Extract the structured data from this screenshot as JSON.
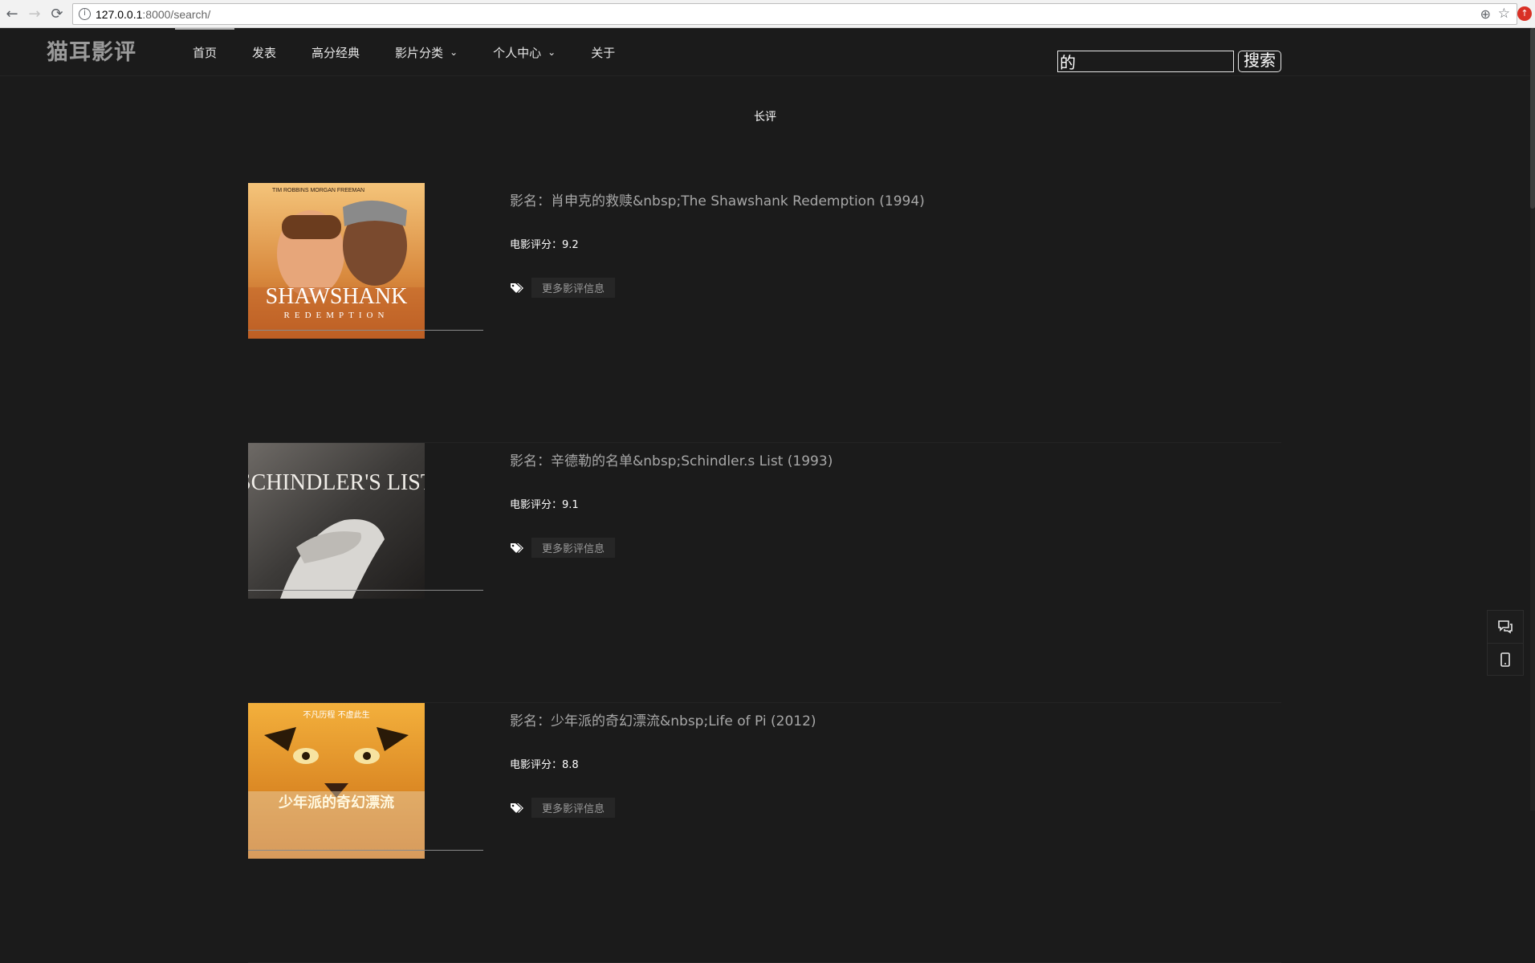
{
  "browser": {
    "url_host": "127.0.0.1",
    "url_rest": ":8000/search/"
  },
  "header": {
    "logo": "猫耳影评",
    "menu": [
      {
        "label": "首页"
      },
      {
        "label": "发表"
      },
      {
        "label": "高分经典"
      },
      {
        "label": "影片分类"
      },
      {
        "label": "个人中心"
      },
      {
        "label": "关于"
      }
    ],
    "search_value": "的",
    "search_button": "搜索"
  },
  "section_title": "长评",
  "movies": [
    {
      "title": "影名：肖申克的救赎&nbsp;The Shawshank Redemption (1994)",
      "score": "电影评分：9.2",
      "tag": "更多影评信息",
      "poster_top": "TIM ROBBINS   MORGAN FREEMAN",
      "poster_title": "SHAWSHANK",
      "poster_sub": "REDEMPTION"
    },
    {
      "title": "影名：辛德勒的名单&nbsp;Schindler.s List (1993)",
      "score": "电影评分：9.1",
      "tag": "更多影评信息",
      "poster_title": "SCHINDLER'S LIST"
    },
    {
      "title": "影名：少年派的奇幻漂流&nbsp;Life of Pi (2012)",
      "score": "电影评分：8.8",
      "tag": "更多影评信息",
      "poster_top": "不凡历程  不虚此生",
      "poster_title": "少年派的奇幻漂流"
    }
  ],
  "colors": {
    "background": "#1b1b1b",
    "header_text": "#e6e6e6",
    "title_text": "#a8a8a8"
  },
  "icons": [
    "back-arrow-icon",
    "forward-arrow-icon",
    "reload-icon",
    "info-icon",
    "zoom-icon",
    "star-icon",
    "chevron-down-icon",
    "tags-icon",
    "chat-icon",
    "mobile-icon"
  ]
}
